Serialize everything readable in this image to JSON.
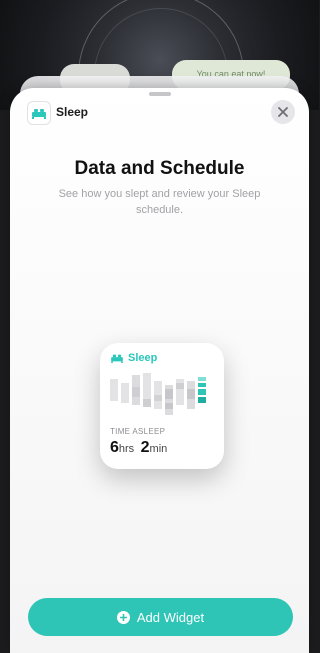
{
  "background": {
    "notification_text": "You can eat now!"
  },
  "sheet": {
    "app_name": "Sleep",
    "app_icon": "bed-icon",
    "close_icon": "close-icon",
    "title": "Data and Schedule",
    "subtitle": "See how you slept and review your Sleep schedule."
  },
  "widget": {
    "header": "Sleep",
    "label": "TIME ASLEEP",
    "hours": "6",
    "hours_unit": "hrs",
    "minutes": "2",
    "minutes_unit": "min"
  },
  "add_button": {
    "label": "Add Widget",
    "icon": "plus-circle-icon"
  },
  "colors": {
    "accent": "#2ec4b6"
  }
}
